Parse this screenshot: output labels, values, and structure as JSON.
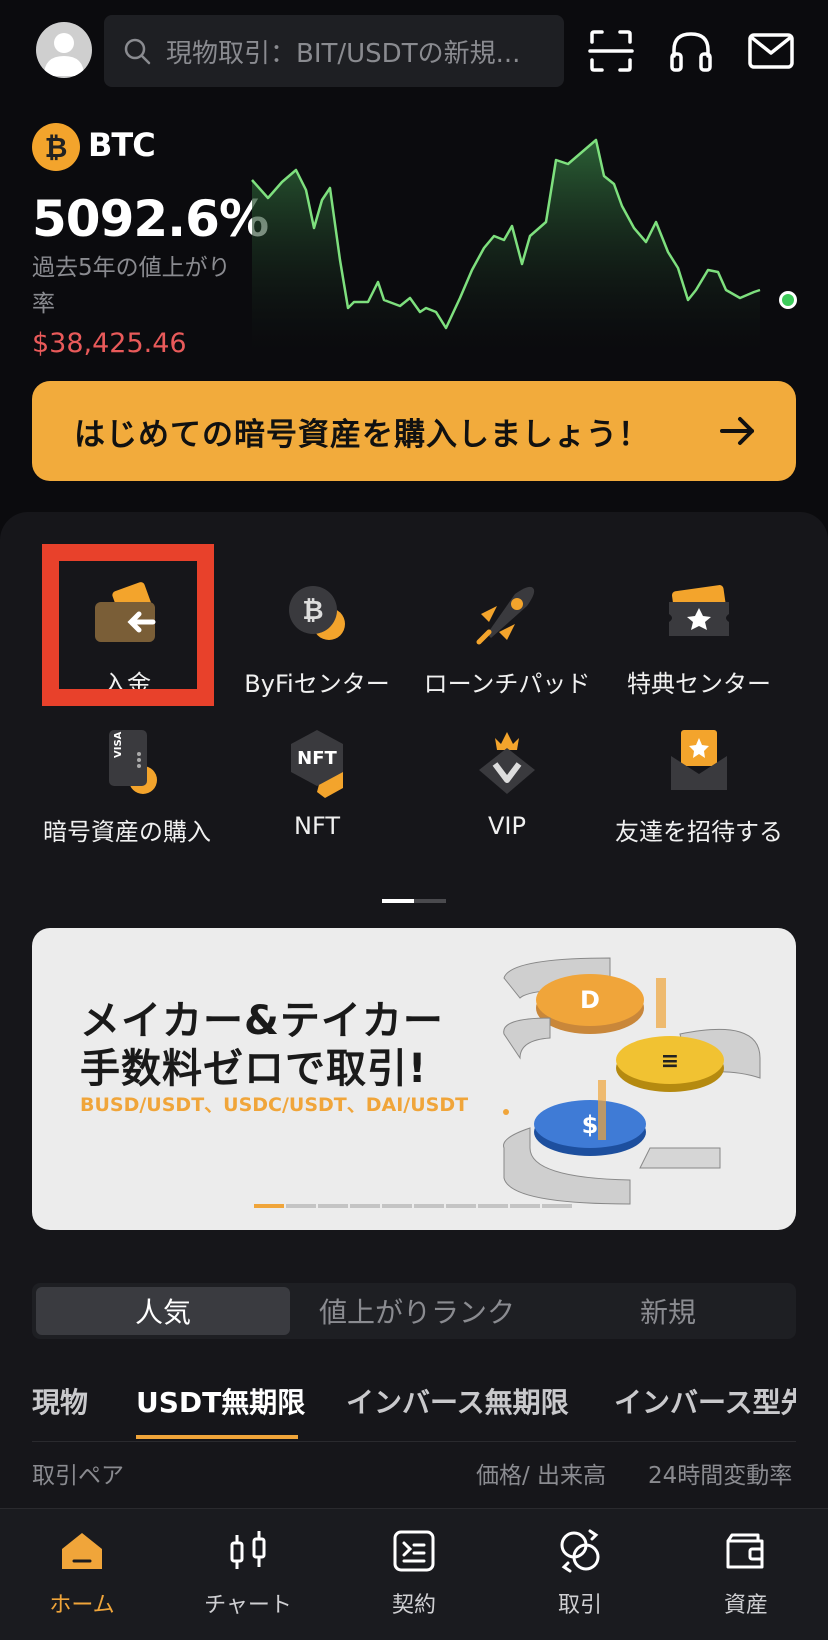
{
  "header": {
    "search_placeholder": "現物取引：BIT/USDTの新規...",
    "icons": [
      "scan-icon",
      "headset-icon",
      "mail-icon"
    ]
  },
  "hero": {
    "coin": "BTC",
    "coin_symbol": "₿",
    "change_pct": "5092.6%",
    "change_desc": "過去5年の値上がり率",
    "price": "$38,425.46",
    "colors": {
      "price": "#e95a5a",
      "line": "#7ee07e"
    }
  },
  "cta": {
    "label": "はじめての暗号資産を購入しましょう！"
  },
  "quick_actions": [
    {
      "label": "入金",
      "icon": "deposit-wallet-icon"
    },
    {
      "label": "ByFiセンター",
      "icon": "byfi-bitcoin-icon"
    },
    {
      "label": "ローンチパッド",
      "icon": "launchpad-rocket-icon"
    },
    {
      "label": "特典センター",
      "icon": "reward-ticket-icon"
    },
    {
      "label": "暗号資産の購入",
      "icon": "visa-card-icon"
    },
    {
      "label": "NFT",
      "icon": "nft-icon"
    },
    {
      "label": "VIP",
      "icon": "vip-crown-icon"
    },
    {
      "label": "友達を招待する",
      "icon": "invite-envelope-icon"
    }
  ],
  "banner": {
    "line1": "メイカー&テイカー",
    "line2": "手数料ゼロで取引!",
    "sub": "BUSD/USDT、USDC/USDT、DAI/USDT"
  },
  "segments": [
    {
      "label": "人気",
      "active": true
    },
    {
      "label": "値上がりランク",
      "active": false
    },
    {
      "label": "新規",
      "active": false
    }
  ],
  "market_tabs": [
    {
      "label": "現物",
      "active": false
    },
    {
      "label": "USDT無期限",
      "active": true
    },
    {
      "label": "インバース無期限",
      "active": false
    },
    {
      "label": "インバース型先",
      "active": false
    }
  ],
  "columns": {
    "pair": "取引ペア",
    "price": "価格/ 出来高",
    "change": "24時間変動率"
  },
  "bottom_nav": [
    {
      "label": "ホーム",
      "icon": "home-icon",
      "active": true
    },
    {
      "label": "チャート",
      "icon": "candlestick-icon",
      "active": false
    },
    {
      "label": "契約",
      "icon": "contract-icon",
      "active": false
    },
    {
      "label": "取引",
      "icon": "trade-swap-icon",
      "active": false
    },
    {
      "label": "資産",
      "icon": "wallet-icon",
      "active": false
    }
  ],
  "accent": "#f0a53a"
}
